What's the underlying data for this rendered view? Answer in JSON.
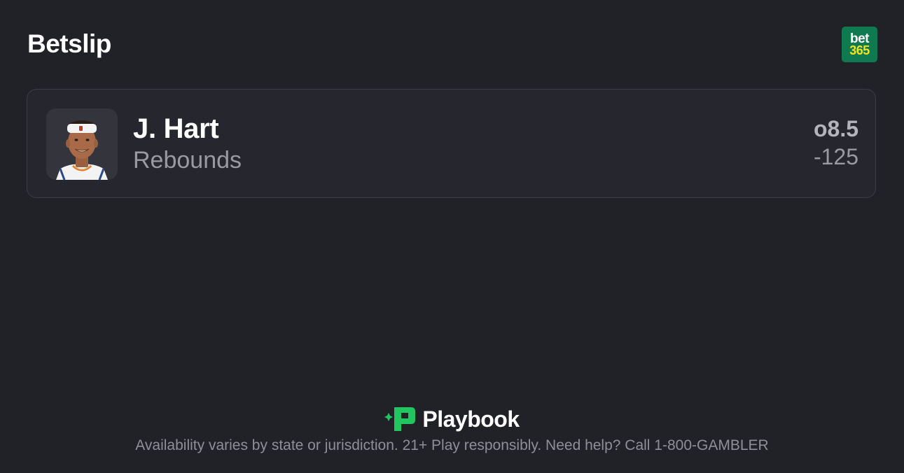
{
  "header": {
    "title": "Betslip",
    "sportsbook": {
      "line1": "bet",
      "line2": "365",
      "bg_color": "#0f7a4f",
      "accent_color": "#f5e31b"
    }
  },
  "bet": {
    "player_name": "J. Hart",
    "market": "Rebounds",
    "line": "o8.5",
    "odds": "-125",
    "avatar_icon": "player-headshot"
  },
  "footer": {
    "brand_name": "Playbook",
    "brand_color": "#22c55e",
    "disclaimer": "Availability varies by state or jurisdiction. 21+ Play responsibly. Need help? Call 1-800-GAMBLER"
  }
}
